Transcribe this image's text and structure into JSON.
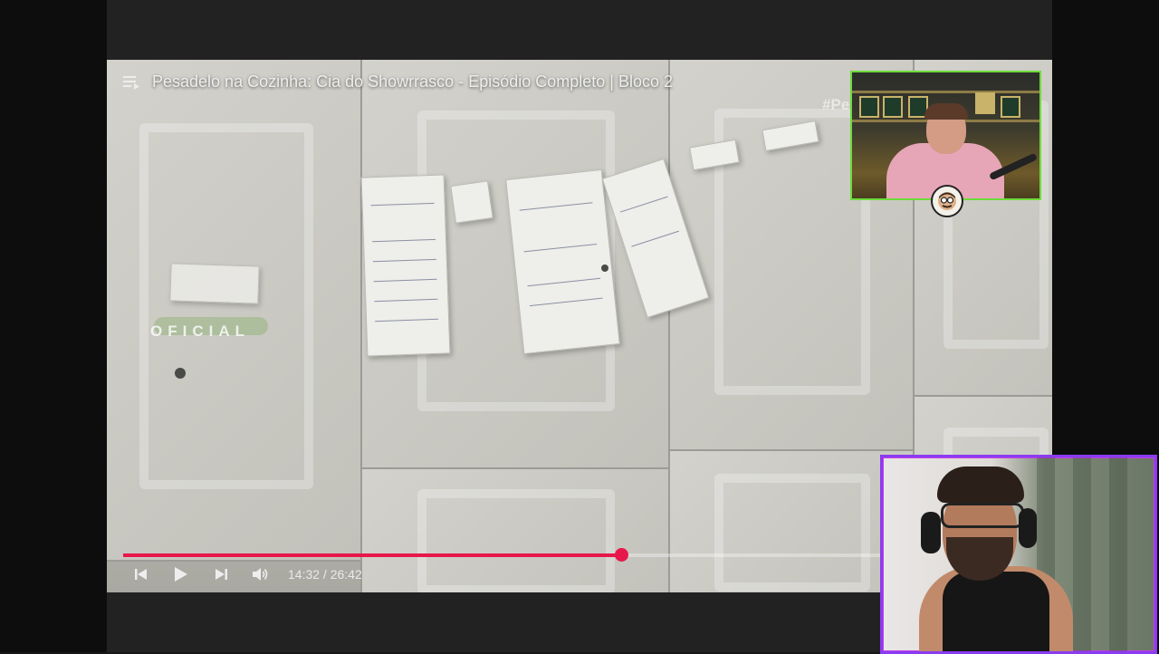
{
  "video": {
    "title": "Pesadelo na Cozinha: Cia do Showrrasco - Episódio Completo | Bloco 2",
    "hashtag": "#Pe",
    "watermark": "OFICIAL",
    "current_time": "14:32",
    "duration": "26:42",
    "time_display": "14:32 / 26:42",
    "progress_fraction": 0.545,
    "buffered_fraction": 0.567
  },
  "controls": {
    "previous": "skip-previous-icon",
    "play": "play-icon",
    "next": "skip-next-icon",
    "volume": "volume-icon",
    "playlist": "playlist-icon"
  },
  "colors": {
    "progress": "#e8174b",
    "webcam_top_border": "#6cdc3a",
    "webcam_bottom_border": "#8a3cf0"
  }
}
